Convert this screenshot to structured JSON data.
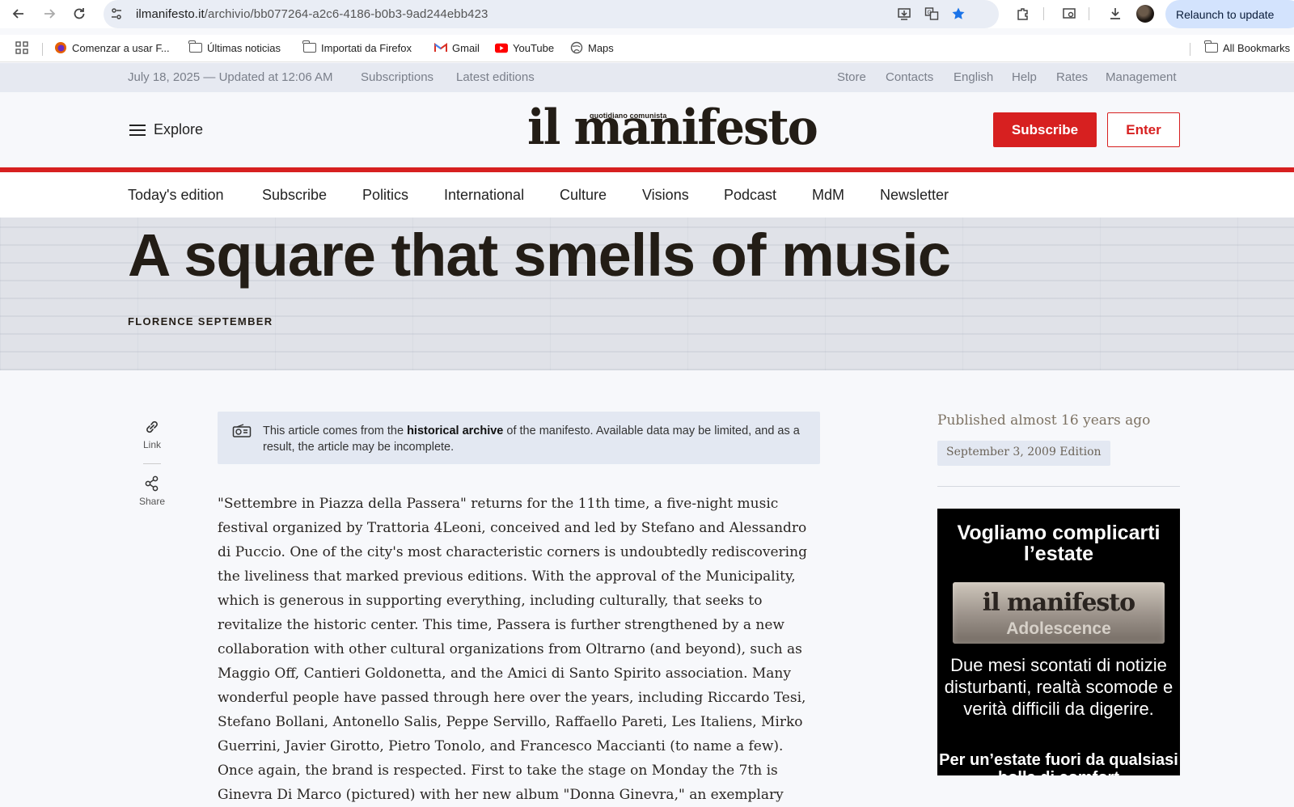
{
  "browser": {
    "url_host": "ilmanifesto.it",
    "url_path": "/archivio/bb077264-a2c6-4186-b0b3-9ad244ebb423",
    "relaunch_label": "Relaunch to update",
    "bookmarks": [
      {
        "label": "Comenzar a usar F...",
        "icon": "firefox-icon"
      },
      {
        "label": "Últimas noticias",
        "icon": "folder-icon"
      },
      {
        "label": "Importati da Firefox",
        "icon": "folder-icon"
      },
      {
        "label": "Gmail",
        "icon": "gmail-icon"
      },
      {
        "label": "YouTube",
        "icon": "youtube-icon"
      },
      {
        "label": "Maps",
        "icon": "maps-icon"
      }
    ],
    "all_bookmarks_label": "All Bookmarks"
  },
  "utility": {
    "date": "July 18, 2025 — Updated at 12:06 AM",
    "left_links": [
      "Subscriptions",
      "Latest editions"
    ],
    "right_links": [
      "Store",
      "Contacts",
      "English",
      "Help",
      "Rates",
      "Management"
    ]
  },
  "masthead": {
    "explore_label": "Explore",
    "logo": "il manifesto",
    "logo_tagline": "quotidiano comunista",
    "subscribe_label": "Subscribe",
    "enter_label": "Enter",
    "accent_color": "#d72020"
  },
  "sections": [
    "Today's edition",
    "Subscribe",
    "Politics",
    "International",
    "Culture",
    "Visions",
    "Podcast",
    "MdM",
    "Newsletter"
  ],
  "article": {
    "title": "A square that smells of music",
    "byline": "FLORENCE SEPTEMBER",
    "tools": {
      "link_label": "Link",
      "share_label": "Share"
    },
    "archive_note": {
      "prefix": "This article comes from the ",
      "bold": "historical archive",
      "suffix": " of the manifesto. Available data may be limited, and as a result, the article may be incomplete."
    },
    "body": "\"Settembre in Piazza della Passera\" returns for the 11th time, a five-night music festival organized by Trattoria 4Leoni, conceived and led by Stefano and Alessandro di Puccio. One of the city's most characteristic corners is undoubtedly rediscovering the liveliness that marked previous editions. With the approval of the Municipality, which is generous in supporting everything, including culturally, that seeks to revitalize the historic center. This time, Passera is further strengthened by a new collaboration with other cultural organizations from Oltrarno (and beyond), such as Maggio Off, Cantieri Goldonetta, and the Amici di Santo Spirito association. Many wonderful people have passed through here over the years, including Riccardo Tesi, Stefano Bollani, Antonello Salis, Peppe Servillo, Raffaello Pareti, Les Italiens, Mirko Guerrini, Javier Girotto, Pietro Tonolo, and Francesco Maccianti (to name a few). Once again, the brand is respected. First to take the stage on Monday the 7th is Ginevra Di Marco (pictured) with her new album \"Donna Ginevra,\" an exemplary"
  },
  "sidebar": {
    "published": "Published almost 16 years ago",
    "edition": "September 3, 2009 Edition",
    "ad": {
      "headline": "Vogliamo complicarti l’estate",
      "banner_logo": "il manifesto",
      "banner_sub": "Adolescence",
      "body": "Due mesi scontati di notizie disturbanti, realtà scomode e verità difficili da digerire.",
      "foot": "Per un’estate fuori da qualsiasi bolla di comfort"
    }
  }
}
